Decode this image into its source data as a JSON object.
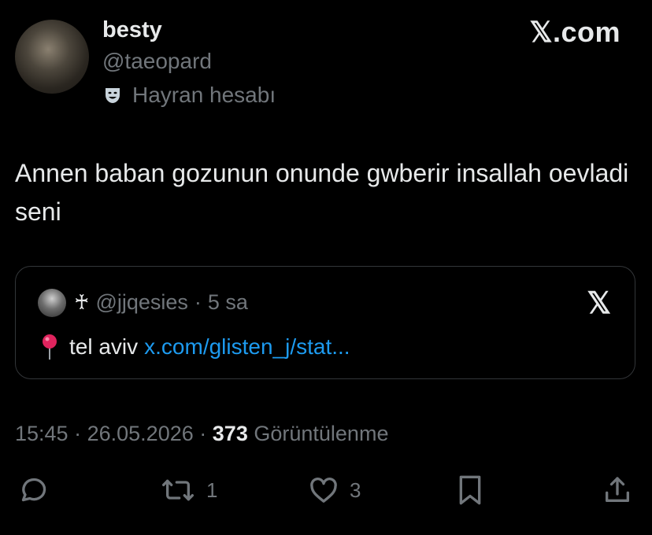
{
  "user": {
    "display_name": "besty",
    "handle": "@taeopard",
    "label_icon": "theater-mask-icon",
    "label_text": "Hayran hesabı"
  },
  "brand": {
    "logo_text": "𝕏.com"
  },
  "tweet": {
    "text": "Annen baban gozunun onunde gwberir insallah oevladi seni"
  },
  "quote": {
    "cross": "♰",
    "handle": "@jjqesies",
    "separator": "·",
    "time": "5 sa",
    "logo": "𝕏",
    "pin_icon": "round-pushpin-icon",
    "text": "tel aviv",
    "link": "x.com/glisten_j/stat..."
  },
  "meta": {
    "time": "15:45",
    "sep1": "·",
    "date": "26.05.2026",
    "sep2": "·",
    "views_count": "373",
    "views_label": "Görüntülenme"
  },
  "actions": {
    "reply_count": "",
    "retweet_count": "1",
    "like_count": "3"
  },
  "colors": {
    "background": "#000000",
    "text": "#e7e9ea",
    "secondary": "#71767b",
    "link": "#1d9bf0",
    "border": "#333639"
  }
}
